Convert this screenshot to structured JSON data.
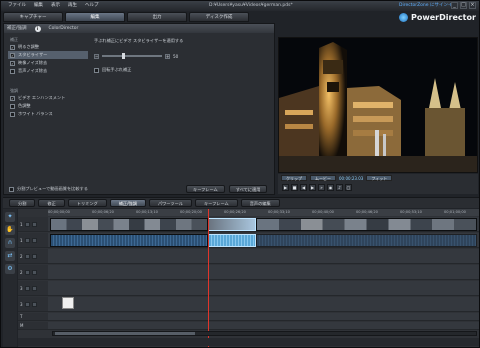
{
  "window": {
    "menu": [
      "ファイル",
      "編集",
      "表示",
      "再生",
      "ヘルプ"
    ],
    "file_path": "D:¥Users¥yasu¥Videos¥german.pds*",
    "directorzone_link": "DirectorZone にサインイン",
    "window_controls": [
      "_",
      "□",
      "×"
    ],
    "brand_name": "PowerDirector"
  },
  "mode_tabs": [
    {
      "label": "キャプチャー",
      "active": false
    },
    {
      "label": "編集",
      "active": true
    },
    {
      "label": "出力",
      "active": false
    },
    {
      "label": "ディスク作成",
      "active": false
    }
  ],
  "fix_room": {
    "header_title": "補正/強調",
    "header_info": "i",
    "header_colordirector": "ColorDirector",
    "sections": [
      {
        "title": "補正",
        "items": [
          {
            "label": "明るさ調整",
            "checked": true,
            "selected": false
          },
          {
            "label": "スタビライザー",
            "checked": true,
            "selected": true
          },
          {
            "label": "映像ノイズ除去",
            "checked": true,
            "selected": false
          },
          {
            "label": "音声ノイズ除去",
            "checked": false,
            "selected": false
          }
        ]
      },
      {
        "title": "強調",
        "items": [
          {
            "label": "ビデオ エンハンスメント",
            "checked": true,
            "selected": false
          },
          {
            "label": "色調整",
            "checked": false,
            "selected": false
          },
          {
            "label": "ホワイト バランス",
            "checked": false,
            "selected": false
          }
        ]
      }
    ],
    "option_text": "手ぶれ補正にビデオ スタビライザーを適用する",
    "slider_value": "50",
    "rotation_checkbox": "回転手ぶれ補正",
    "bottom_checkbox": "分割プレビューで動画画質を比較する",
    "keyframe_button": "キーフレーム",
    "apply_all_button": "すべてに適用"
  },
  "preview": {
    "clip_tag": "クリップ",
    "movie_tag": "ムービー",
    "fit_label": "フィット",
    "timecode": "00:00:23.03"
  },
  "timeline_tabs": [
    {
      "label": "分割",
      "active": false
    },
    {
      "label": "修正",
      "active": false
    },
    {
      "label": "トリミング",
      "active": false
    },
    {
      "label": "補正/強調",
      "active": true
    },
    {
      "label": "パワーツール",
      "active": false
    },
    {
      "label": "キーフレーム",
      "active": false
    },
    {
      "label": "音声の編集",
      "active": false
    }
  ],
  "ruler_ticks": [
    "00;00;00;00",
    "00;00;06;20",
    "00;00;13;10",
    "00;00;20;00",
    "00;00;26;20",
    "00;00;33;10",
    "00;00;40;00",
    "00;00;46;20",
    "00;00;53;10",
    "00;01;00;00"
  ],
  "tracks": [
    {
      "label": "1"
    },
    {
      "label": "1"
    },
    {
      "label": "2"
    },
    {
      "label": "2"
    },
    {
      "label": "3"
    },
    {
      "label": "3"
    },
    {
      "label": "T"
    },
    {
      "label": "M"
    }
  ],
  "tool_icons": [
    "fx-icon",
    "hand-icon",
    "magnet-icon",
    "arrows-icon",
    "tools-icon"
  ]
}
